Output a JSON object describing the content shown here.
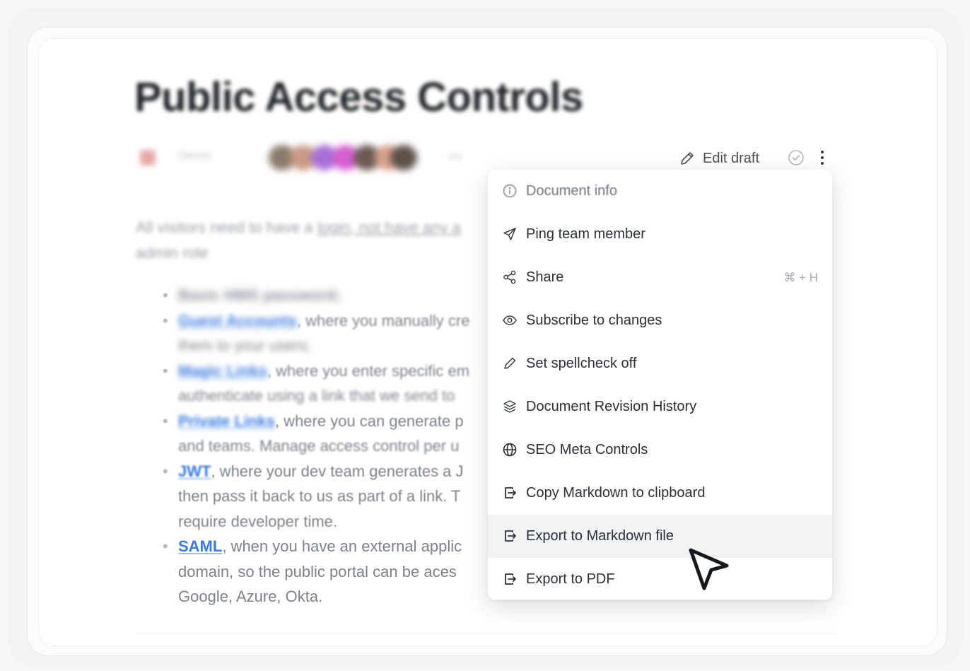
{
  "document": {
    "title": "Public Access Controls",
    "meta_label": "Owner",
    "meta_small": "4/4",
    "intro_line1_a": "All visitors need to have a ",
    "intro_line1_link": "login, not have any a",
    "intro_line2": "admin role",
    "list": [
      {
        "term": "",
        "lines": [
          "Basic HMS password;"
        ]
      },
      {
        "term": "Guest Accounts",
        "lines": [
          ", where you manually cre",
          "them to your users;"
        ]
      },
      {
        "term": "Magic Links",
        "lines": [
          ", where you enter specific em",
          "authenticate using a link that we send to"
        ]
      },
      {
        "term": "Private Links",
        "lines": [
          ", where you can generate p",
          "and teams. Manage access control per u"
        ]
      },
      {
        "term": "JWT",
        "lines": [
          ", where your dev team generates a J",
          "then pass it back to us as part of a link. T",
          "require developer time."
        ]
      },
      {
        "term": "SAML",
        "lines": [
          ", when you have an external applic",
          "domain, so the public portal can be aces",
          "Google, Azure, Okta."
        ]
      }
    ]
  },
  "toolbar": {
    "edit_draft_label": "Edit draft"
  },
  "menu": {
    "items": [
      {
        "label": "Document info",
        "icon": "info-icon"
      },
      {
        "label": "Ping team member",
        "icon": "send-icon"
      },
      {
        "label": "Share",
        "icon": "share-icon",
        "shortcut": "⌘ + H"
      },
      {
        "label": "Subscribe to changes",
        "icon": "eye-icon"
      },
      {
        "label": "Set spellcheck off",
        "icon": "pencil-icon"
      },
      {
        "label": "Document Revision History",
        "icon": "layers-icon"
      },
      {
        "label": "SEO Meta Controls",
        "icon": "globe-icon"
      },
      {
        "label": "Copy Markdown to clipboard",
        "icon": "export-icon"
      },
      {
        "label": "Export to Markdown file",
        "icon": "export-icon",
        "highlighted": true
      },
      {
        "label": "Export to PDF",
        "icon": "export-icon"
      }
    ]
  },
  "colors": {
    "link": "#3b7be0",
    "menu_highlight": "#f1f3f5",
    "text": "#2b3035"
  }
}
